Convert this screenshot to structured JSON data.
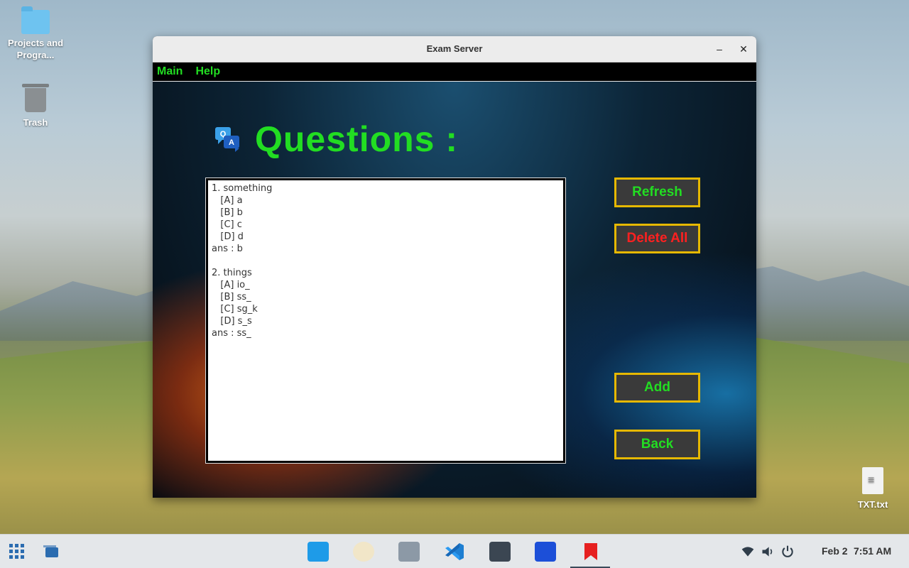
{
  "desktop": {
    "icons": [
      {
        "label": "Projects and Progra..."
      },
      {
        "label": "Trash"
      },
      {
        "label": "TXT.txt"
      }
    ]
  },
  "window": {
    "title": "Exam Server",
    "minimize": "–",
    "close": "✕",
    "menu": {
      "main": "Main",
      "help": "Help"
    },
    "heading": "Questions :",
    "questions_text": "1. something\n   [A] a\n   [B] b\n   [C] c\n   [D] d\nans : b\n\n2. things\n   [A] io_\n   [B] ss_\n   [C] sg_k\n   [D] s_s\nans : ss_",
    "buttons": {
      "refresh": "Refresh",
      "delete_all": "Delete All",
      "add": "Add",
      "back": "Back"
    },
    "colors": {
      "accent": "#22dd22",
      "danger": "#ff2020",
      "button_border": "#e6b800"
    }
  },
  "taskbar": {
    "date": "Feb 2",
    "time": "7:51 AM",
    "apps": [
      "app-grid",
      "window-switcher",
      "software-store",
      "rhythmbox",
      "files",
      "vscode",
      "terminal",
      "reader",
      "bookmark"
    ]
  }
}
